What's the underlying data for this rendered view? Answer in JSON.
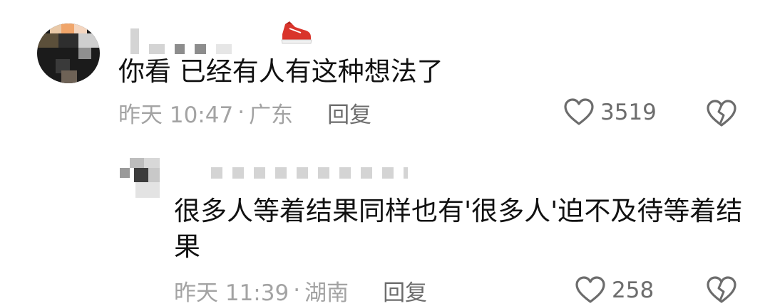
{
  "comments": [
    {
      "text": "你看 已经有人有这种想法了",
      "time": "昨天 10:47",
      "separator": "·",
      "location": "广东",
      "reply_label": "回复",
      "likes": "3519"
    },
    {
      "text": "很多人等着结果同样也有'很多人'迫不及待等着结果",
      "time": "昨天 11:39",
      "separator": "·",
      "location": "湖南",
      "reply_label": "回复",
      "likes": "258"
    }
  ],
  "colors": {
    "text": "#111111",
    "meta": "#a3a3a3",
    "action": "#6c6c6c",
    "badge": "#d9342b"
  },
  "icons": {
    "like": "heart-outline-icon",
    "dislike": "broken-heart-icon",
    "badge": "red-sneaker-icon"
  }
}
